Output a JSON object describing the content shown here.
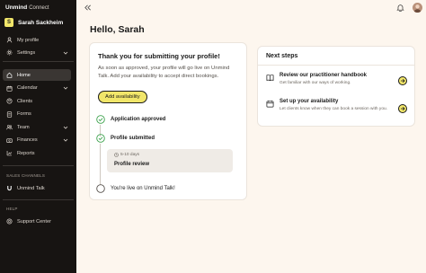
{
  "sidebar": {
    "brand": {
      "name": "Unmind",
      "product": "Connect"
    },
    "user": {
      "initial": "S",
      "name": "Sarah Sackheim"
    },
    "items_top": [
      {
        "label": "My profile",
        "icon": "user-icon"
      },
      {
        "label": "Settings",
        "icon": "gear-icon"
      }
    ],
    "items_main": [
      {
        "label": "Home",
        "icon": "home-icon",
        "active": true
      },
      {
        "label": "Calendar",
        "icon": "calendar-icon"
      },
      {
        "label": "Clients",
        "icon": "clients-icon"
      },
      {
        "label": "Forms",
        "icon": "forms-icon"
      },
      {
        "label": "Team",
        "icon": "team-icon"
      },
      {
        "label": "Finances",
        "icon": "finances-icon"
      },
      {
        "label": "Reports",
        "icon": "reports-icon"
      }
    ],
    "sales_heading": "SALES CHANNELS",
    "sales_item": {
      "label": "Unmind Talk",
      "icon": "unmind-u-icon"
    },
    "help_heading": "HELP",
    "help_item": {
      "label": "Support Center",
      "icon": "support-icon"
    }
  },
  "header": {
    "greeting": "Hello, Sarah"
  },
  "profile_card": {
    "title": "Thank you for submitting your profile!",
    "description": "As soon as approved, your profile will go live on Unmind Talk. Add your availability to accept direct bookings.",
    "button": "Add availability",
    "steps": [
      {
        "label": "Application approved",
        "done": true
      },
      {
        "label": "Profile submitted",
        "done": true
      }
    ],
    "review": {
      "duration": "5-10 days",
      "title": "Profile review"
    },
    "final_step": "You're live on Unmind Talk!"
  },
  "next_steps": {
    "title": "Next steps",
    "items": [
      {
        "title": "Review our practitioner handbook",
        "desc": "Get familiar with our ways of working.",
        "icon": "book-icon"
      },
      {
        "title": "Set up your availability",
        "desc": "Let clients know when they can book a session with you.",
        "icon": "calendar-icon"
      }
    ]
  },
  "colors": {
    "accent": "#f1e66a",
    "success": "#3aa14a",
    "sidebar": "#171412",
    "background": "#fdf6ee"
  }
}
